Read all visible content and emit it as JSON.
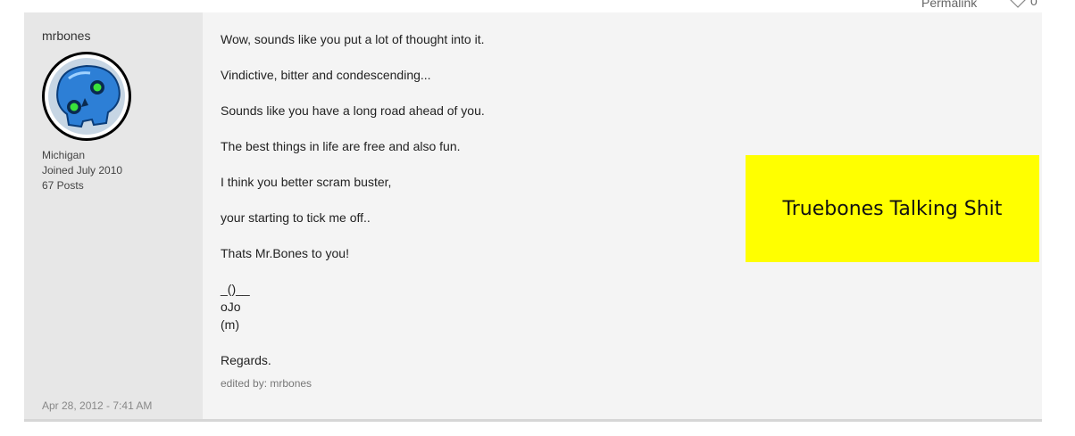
{
  "header": {
    "permalink_label": "Permalink",
    "like_count": "0",
    "like_icon": "heart-outline-icon"
  },
  "author": {
    "username": "mrbones",
    "avatar_icon": "blue-skull-avatar",
    "location": "Michigan",
    "joined": "Joined July 2010",
    "posts": "67 Posts"
  },
  "post": {
    "lines": [
      "Wow, sounds like you put a lot of thought into it.",
      "Vindictive, bitter and condescending...",
      "Sounds like you have a long road ahead of you.",
      "The best things in life are free and also fun.",
      "I think you better scram buster,",
      "your starting to tick me off..",
      "Thats Mr.Bones to you!",
      "_()__",
      "oJo",
      "(m)",
      "Regards."
    ],
    "edited_by": "edited by: mrbones",
    "timestamp": "Apr 28, 2012 - 7:41 AM"
  },
  "overlay": {
    "text": "Truebones Talking Shit",
    "color": "#ffff00"
  },
  "colors": {
    "sidebar_bg": "#e7e7e7",
    "post_bg": "#f4f4f4"
  }
}
